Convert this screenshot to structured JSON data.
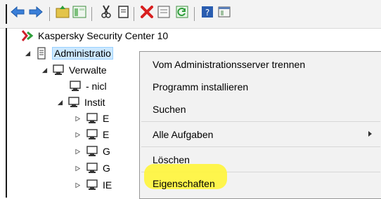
{
  "toolbar": {
    "icons": [
      "back-icon",
      "forward-icon",
      "folder-up-icon",
      "show-hide-tree-icon",
      "cut-icon",
      "copy-icon",
      "delete-icon",
      "properties-icon",
      "refresh-icon",
      "help-icon",
      "console-window-icon"
    ]
  },
  "tree": {
    "root": {
      "label": "Kaspersky Security Center 10",
      "icon": "kaspersky-logo-icon"
    },
    "server": {
      "label": "Administratio",
      "icon": "server-icon"
    },
    "children": [
      {
        "label": "Verwalte",
        "icon": "computer-icon",
        "expander": "expanded"
      },
      {
        "label": "- nicl",
        "icon": "computer-icon",
        "expander": "none"
      },
      {
        "label": "Instit",
        "icon": "computer-icon",
        "expander": "expanded"
      },
      {
        "label": "E",
        "icon": "computer-icon",
        "expander": "collapsed"
      },
      {
        "label": "E",
        "icon": "computer-icon",
        "expander": "collapsed"
      },
      {
        "label": "G",
        "icon": "computer-icon",
        "expander": "collapsed"
      },
      {
        "label": "G",
        "icon": "computer-icon",
        "expander": "collapsed"
      },
      {
        "label": "IE",
        "icon": "computer-icon",
        "expander": "collapsed"
      }
    ]
  },
  "context_menu": {
    "items": [
      {
        "label": "Vom Administrationsserver trennen"
      },
      {
        "label": "Programm installieren"
      },
      {
        "label": "Suchen"
      },
      {
        "label": "Alle Aufgaben",
        "submenu": true
      },
      {
        "label": "Löschen"
      },
      {
        "label": "Eigenschaften",
        "highlighted": true
      }
    ]
  },
  "colors": {
    "highlight": "#fff53a",
    "selection": "#cce8ff",
    "menu_bg": "#f2f2f2"
  }
}
